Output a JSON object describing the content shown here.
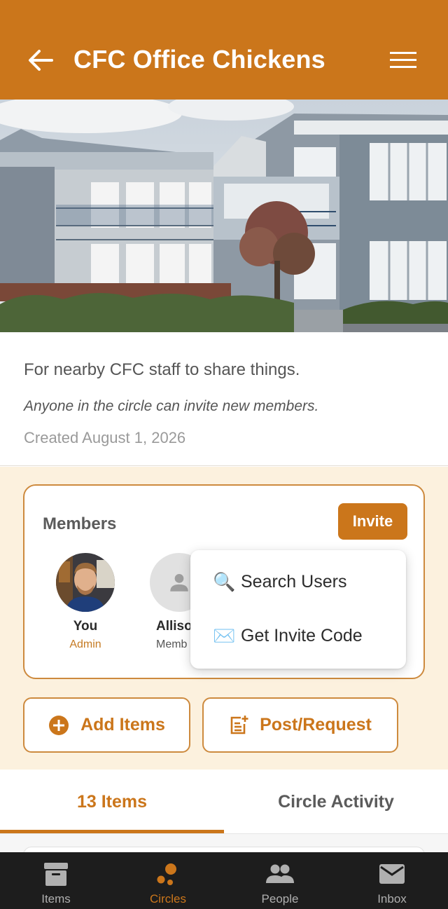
{
  "header": {
    "title": "CFC Office Chickens",
    "back_icon": "arrow-left-icon",
    "menu_icon": "hamburger-menu-icon"
  },
  "circle": {
    "description": "For nearby CFC staff to share things.",
    "invite_policy": "Anyone in the circle can invite new members.",
    "created": "Created August 1, 2026"
  },
  "members": {
    "label": "Members",
    "invite_label": "Invite",
    "list": [
      {
        "name": "You",
        "role": "Admin"
      },
      {
        "name": "Alliso",
        "role": "Memb"
      }
    ]
  },
  "invite_menu": {
    "items": [
      {
        "icon": "🔍",
        "label": "Search Users"
      },
      {
        "icon": "✉️",
        "label": "Get Invite Code"
      }
    ]
  },
  "actions": {
    "add_items": "Add Items",
    "post_request": "Post/Request"
  },
  "tabs": {
    "items": [
      {
        "label": "13 Items",
        "active": true
      },
      {
        "label": "Circle Activity",
        "active": false
      }
    ]
  },
  "bottom_nav": {
    "items": [
      {
        "label": "Items",
        "icon": "archive-box-icon",
        "active": false
      },
      {
        "label": "Circles",
        "icon": "circles-icon",
        "active": true
      },
      {
        "label": "People",
        "icon": "people-icon",
        "active": false
      },
      {
        "label": "Inbox",
        "icon": "mail-icon",
        "active": false
      }
    ]
  },
  "colors": {
    "accent": "#cb761b",
    "cream": "#fcf1de",
    "nav_bg": "#1d1d1d",
    "nav_inactive": "#b0b0b0",
    "admin_role": "#c57a22"
  }
}
